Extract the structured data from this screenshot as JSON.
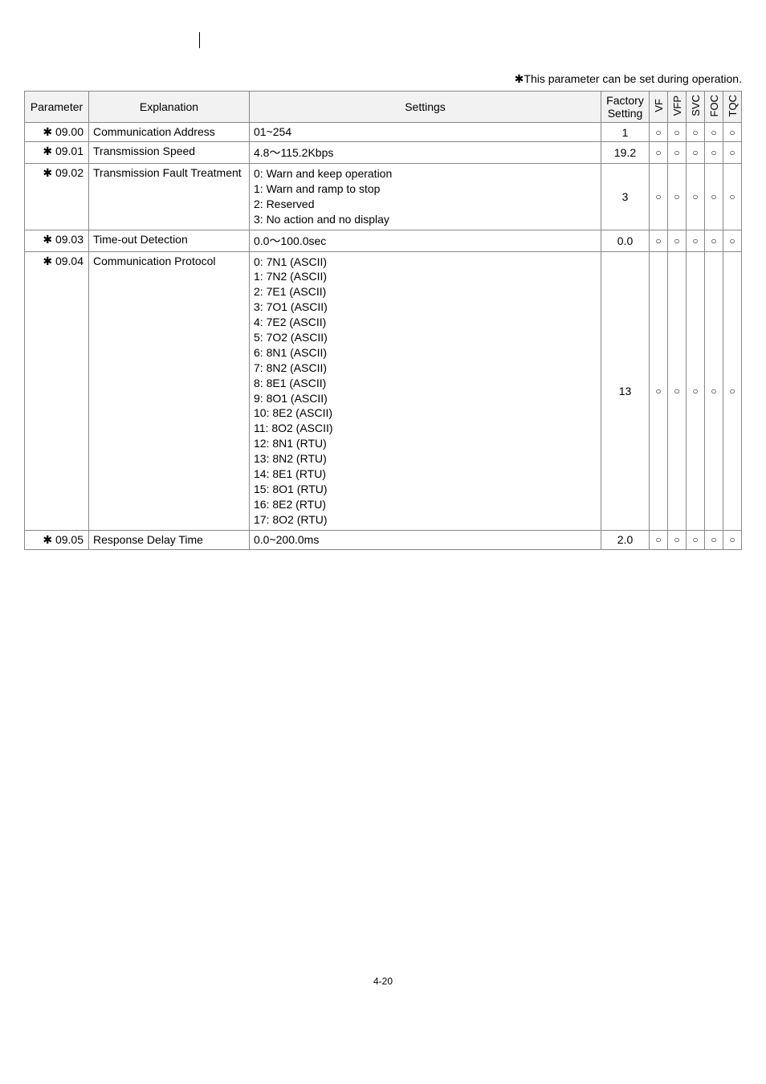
{
  "note": "✱This parameter can be set during operation.",
  "headers": {
    "parameter": "Parameter",
    "explanation": "Explanation",
    "settings": "Settings",
    "factory": "Factory Setting",
    "m1": "VF",
    "m2": "VFP",
    "m3": "SVC",
    "m4": "FOC",
    "m5": "TQC"
  },
  "rows": [
    {
      "param": "✱ 09.00",
      "expl": "Communication Address",
      "set": "01~254",
      "fac": "1",
      "m": [
        "○",
        "○",
        "○",
        "○",
        "○"
      ]
    },
    {
      "param": "✱ 09.01",
      "expl": "Transmission Speed",
      "set": "4.8～115.2Kbps",
      "fac": "19.2",
      "m": [
        "○",
        "○",
        "○",
        "○",
        "○"
      ]
    },
    {
      "param": "✱ 09.02",
      "expl": "Transmission Fault Treatment",
      "set": "0: Warn and keep operation\n1: Warn and ramp to stop\n2: Reserved\n3: No action and no display",
      "fac": "3",
      "m": [
        "○",
        "○",
        "○",
        "○",
        "○"
      ]
    },
    {
      "param": "✱ 09.03",
      "expl": "Time-out Detection",
      "set": "0.0～100.0sec",
      "fac": "0.0",
      "m": [
        "○",
        "○",
        "○",
        "○",
        "○"
      ]
    },
    {
      "param": "✱ 09.04",
      "expl": "Communication Protocol",
      "set": "0: 7N1 (ASCII)\n1: 7N2 (ASCII)\n2: 7E1 (ASCII)\n3: 7O1 (ASCII)\n4: 7E2 (ASCII)\n5: 7O2 (ASCII)\n6: 8N1 (ASCII)\n7: 8N2 (ASCII)\n8: 8E1 (ASCII)\n9: 8O1 (ASCII)\n10: 8E2 (ASCII)\n11: 8O2 (ASCII)\n12: 8N1 (RTU)\n13: 8N2 (RTU)\n14: 8E1 (RTU)\n15: 8O1 (RTU)\n16: 8E2 (RTU)\n17: 8O2 (RTU)",
      "fac": "13",
      "m": [
        "○",
        "○",
        "○",
        "○",
        "○"
      ]
    },
    {
      "param": "✱ 09.05",
      "expl": "Response Delay Time",
      "set": "0.0~200.0ms",
      "fac": "2.0",
      "m": [
        "○",
        "○",
        "○",
        "○",
        "○"
      ]
    }
  ],
  "footer": "4-20"
}
